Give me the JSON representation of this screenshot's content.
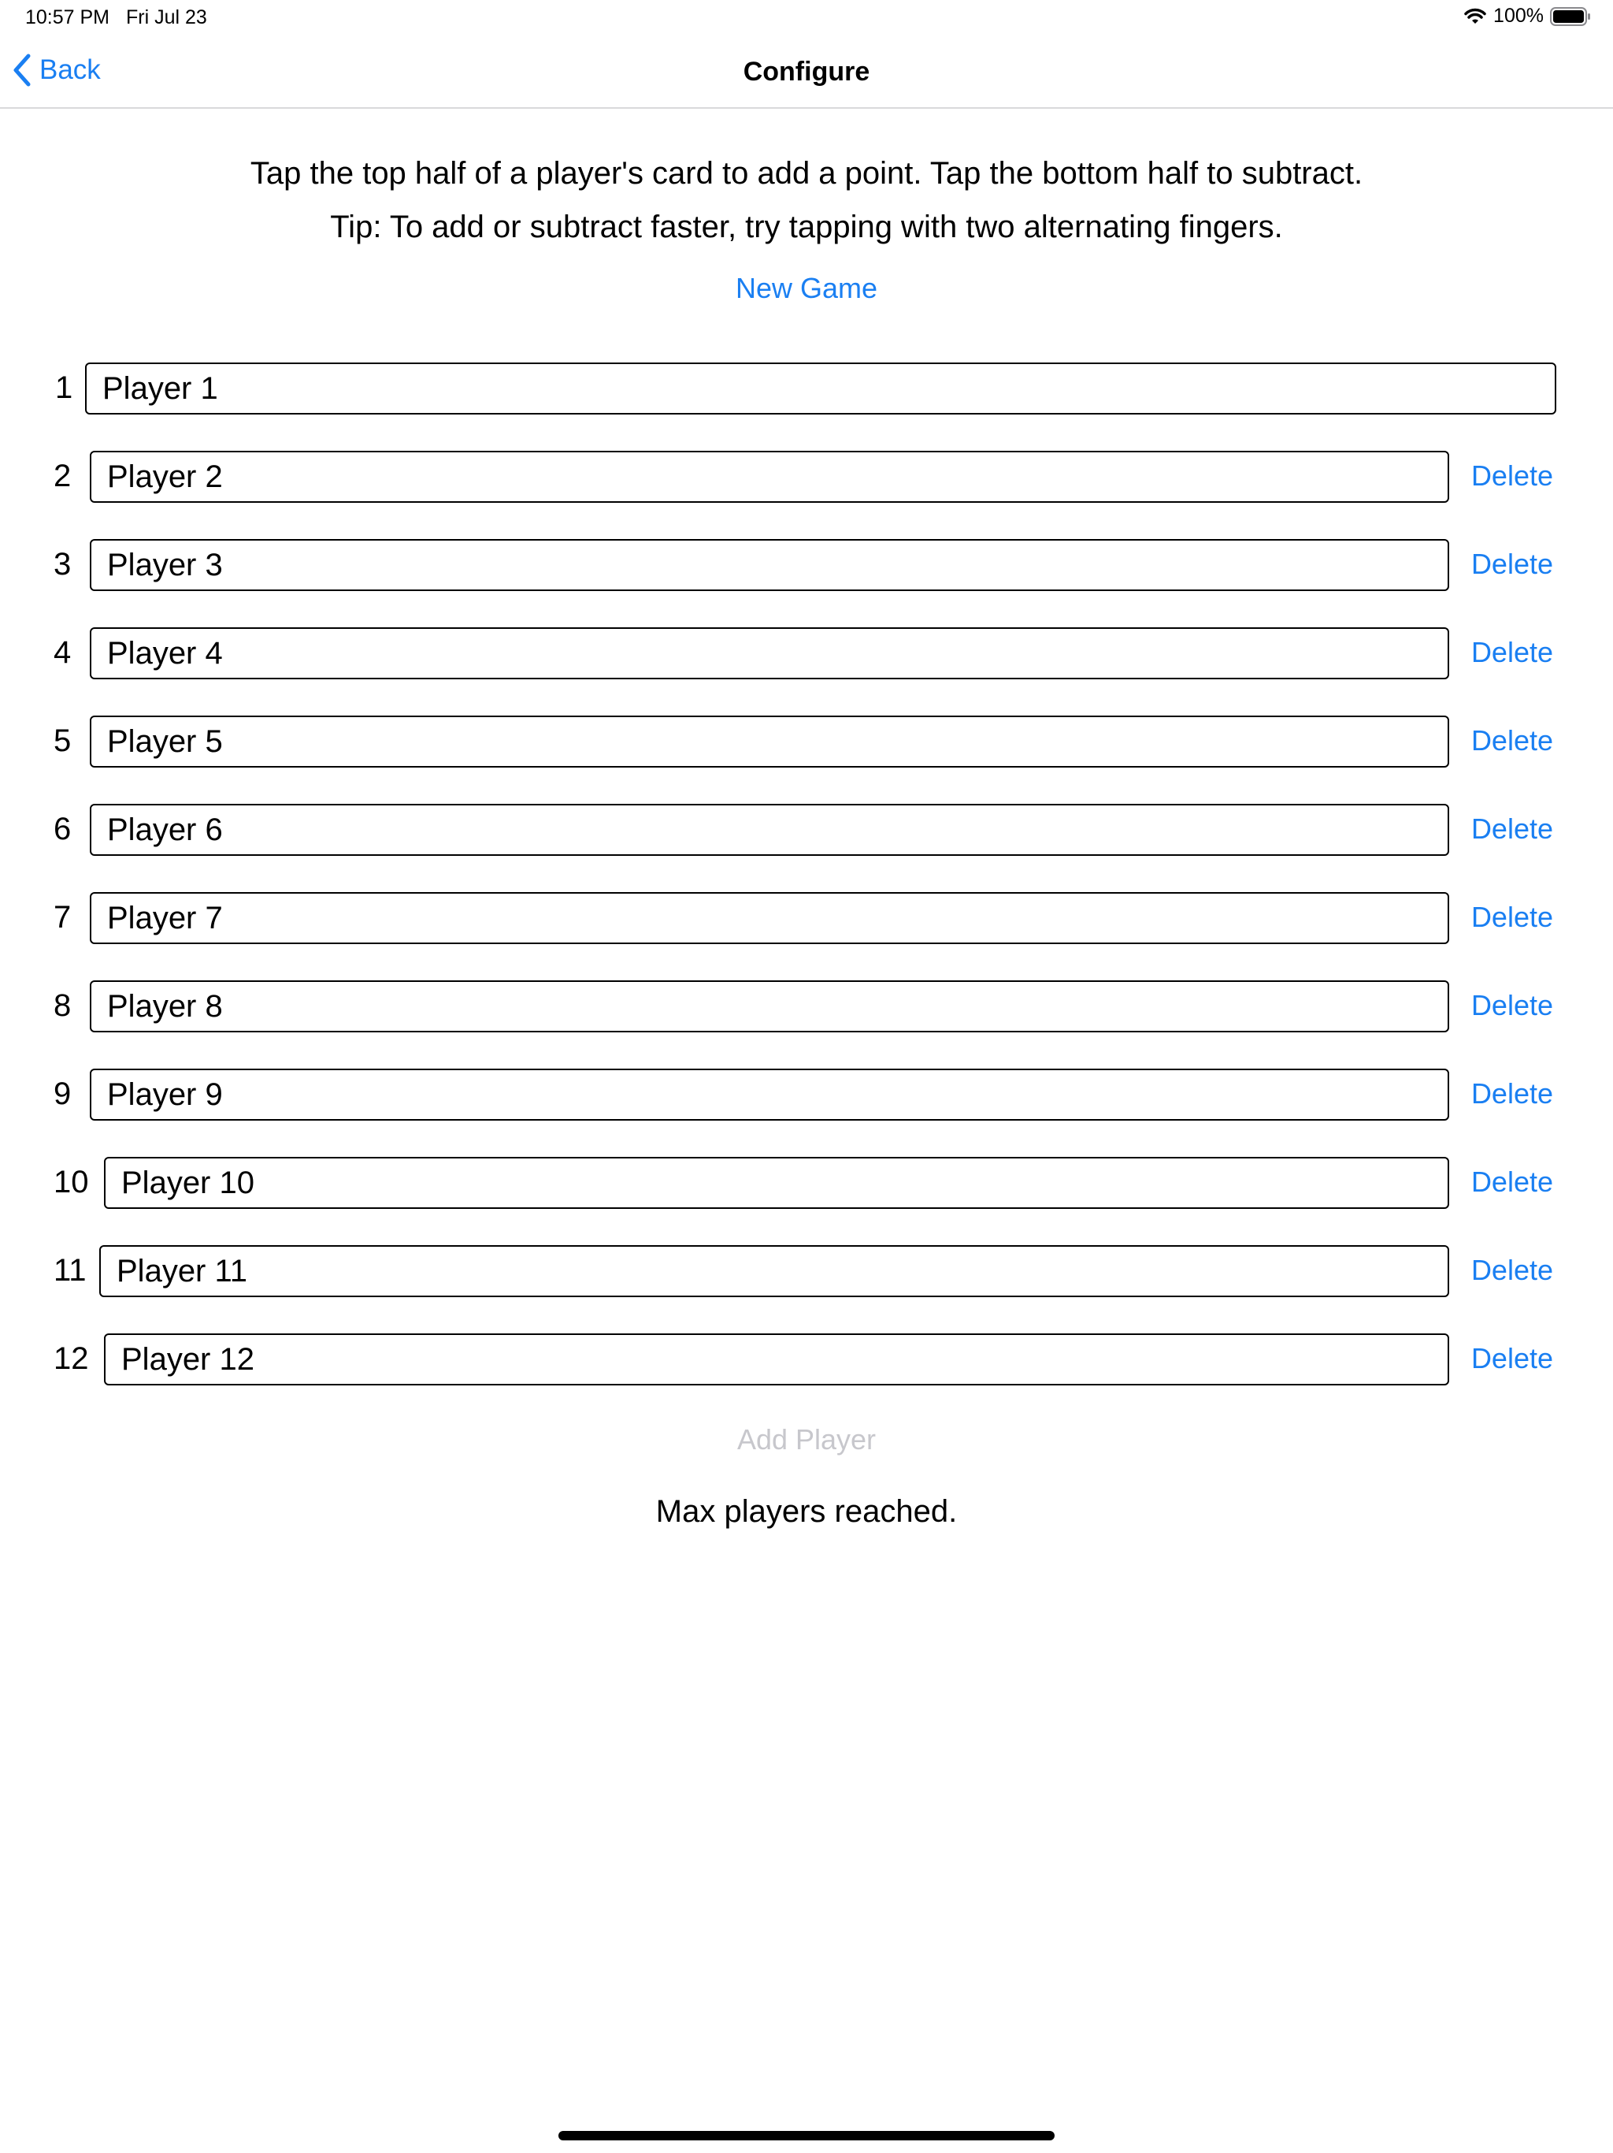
{
  "status_bar": {
    "time": "10:57 PM",
    "date": "Fri Jul 23",
    "battery": "100%"
  },
  "nav": {
    "back_label": "Back",
    "title": "Configure"
  },
  "instructions": {
    "line1": "Tap the top half of a player's card to add a point. Tap the bottom half to subtract.",
    "line2": "Tip: To add or subtract faster, try tapping with two alternating fingers."
  },
  "new_game_label": "New Game",
  "players": [
    {
      "number": "1",
      "name": "Player 1"
    },
    {
      "number": "2",
      "name": "Player 2",
      "delete_label": "Delete"
    },
    {
      "number": "3",
      "name": "Player 3",
      "delete_label": "Delete"
    },
    {
      "number": "4",
      "name": "Player 4",
      "delete_label": "Delete"
    },
    {
      "number": "5",
      "name": "Player 5",
      "delete_label": "Delete"
    },
    {
      "number": "6",
      "name": "Player 6",
      "delete_label": "Delete"
    },
    {
      "number": "7",
      "name": "Player 7",
      "delete_label": "Delete"
    },
    {
      "number": "8",
      "name": "Player 8",
      "delete_label": "Delete"
    },
    {
      "number": "9",
      "name": "Player 9",
      "delete_label": "Delete"
    },
    {
      "number": "10",
      "name": "Player 10",
      "delete_label": "Delete"
    },
    {
      "number": "11",
      "name": "Player 11",
      "delete_label": "Delete"
    },
    {
      "number": "12",
      "name": "Player 12",
      "delete_label": "Delete"
    }
  ],
  "add_player_label": "Add Player",
  "max_players_text": "Max players reached.",
  "colors": {
    "accent": "#1a7ff2",
    "disabled": "#c7c7cc",
    "separator": "#d9d9db"
  }
}
